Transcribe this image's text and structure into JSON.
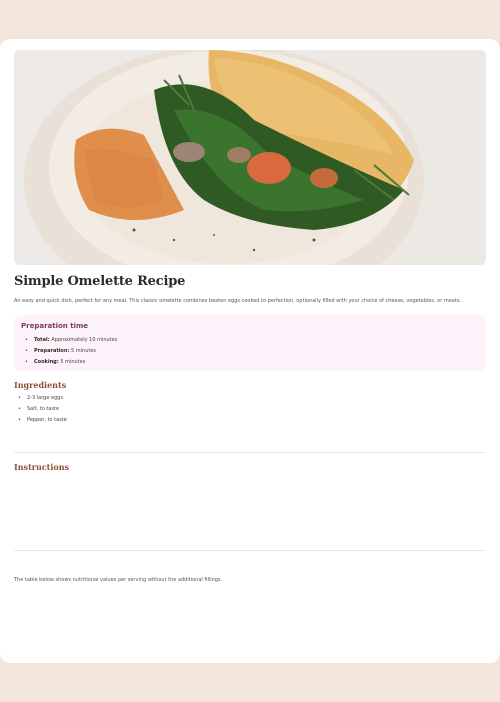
{
  "hero": {
    "image_name": "omelette-photo",
    "colors": {
      "egg": "#e8b766",
      "spinach": "#2f5a24",
      "plate": "#f1e9e0",
      "spread": "#e08e4c"
    }
  },
  "recipe": {
    "title": "Simple Omelette Recipe",
    "intro": "An easy and quick dish, perfect for any meal. This classic omelette combines beaten eggs cooked to perfection, optionally filled with your choice of cheese, vegetables, or meats."
  },
  "prep": {
    "title": "Preparation time",
    "items": [
      {
        "label": "Total",
        "value": "Approximately 10 minutes"
      },
      {
        "label": "Preparation",
        "value": "5 minutes"
      },
      {
        "label": "Cooking",
        "value": "5 minutes"
      }
    ]
  },
  "ingredients": {
    "title": "Ingredients",
    "items": [
      "2-3 large eggs",
      "Salt, to taste",
      "Pepper, to taste"
    ]
  },
  "instructions": {
    "title": "Instructions"
  },
  "nutrition": {
    "note": "The table below shows nutritional values per serving without the additional fillings."
  }
}
